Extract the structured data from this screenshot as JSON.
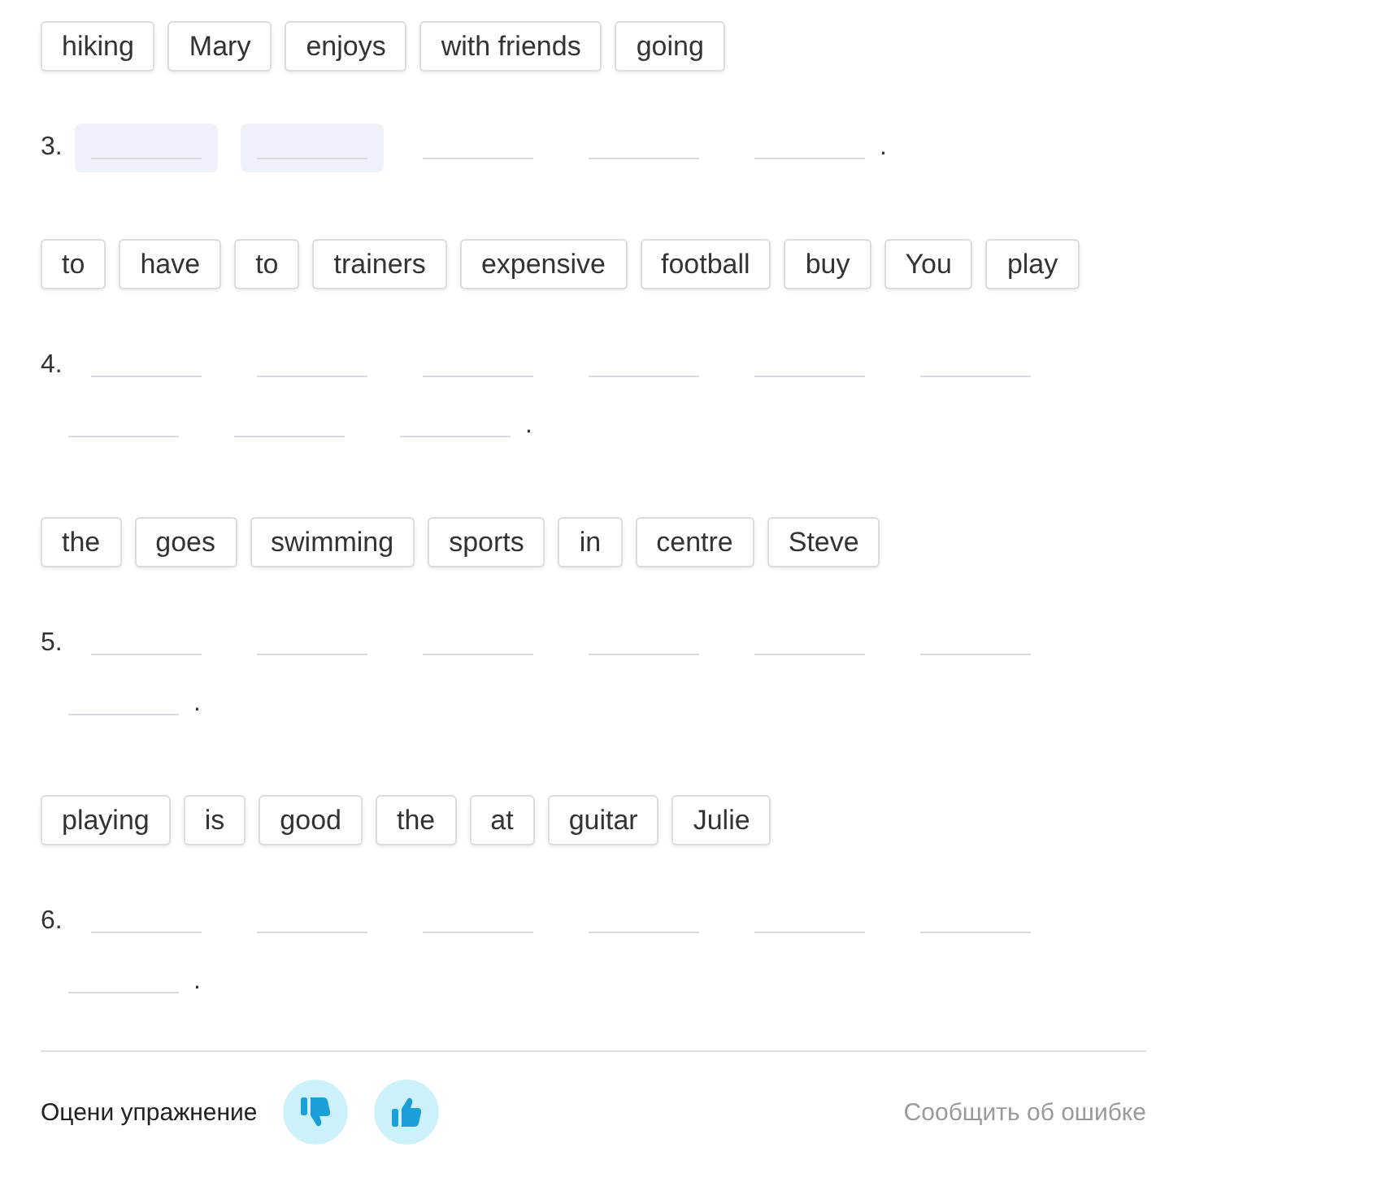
{
  "exercises": [
    {
      "words": [
        "hiking",
        "Mary",
        "enjoys",
        "with friends",
        "going"
      ],
      "number": "3.",
      "blanks": [
        {
          "highlighted": true
        },
        {
          "highlighted": true
        },
        {
          "highlighted": false
        },
        {
          "highlighted": false
        },
        {
          "highlighted": false
        }
      ],
      "end": "."
    },
    {
      "words": [
        "to",
        "have",
        "to",
        "trainers",
        "expensive",
        "football",
        "buy",
        "You",
        "play"
      ],
      "number": "4.",
      "blanks": [
        {
          "highlighted": false
        },
        {
          "highlighted": false
        },
        {
          "highlighted": false
        },
        {
          "highlighted": false
        },
        {
          "highlighted": false
        },
        {
          "highlighted": false
        },
        {
          "highlighted": false
        },
        {
          "highlighted": false
        },
        {
          "highlighted": false
        }
      ],
      "end": "."
    },
    {
      "words": [
        "the",
        "goes",
        "swimming",
        "sports",
        "in",
        "centre",
        "Steve"
      ],
      "number": "5.",
      "blanks": [
        {
          "highlighted": false
        },
        {
          "highlighted": false
        },
        {
          "highlighted": false
        },
        {
          "highlighted": false
        },
        {
          "highlighted": false
        },
        {
          "highlighted": false
        },
        {
          "highlighted": false
        }
      ],
      "end": "."
    },
    {
      "words": [
        "playing",
        "is",
        "good",
        "the",
        "at",
        "guitar",
        "Julie"
      ],
      "number": "6.",
      "blanks": [
        {
          "highlighted": false
        },
        {
          "highlighted": false
        },
        {
          "highlighted": false
        },
        {
          "highlighted": false
        },
        {
          "highlighted": false
        },
        {
          "highlighted": false
        },
        {
          "highlighted": false
        }
      ],
      "end": "."
    }
  ],
  "footer": {
    "rate_label": "Оцени упражнение",
    "report_link": "Сообщить об ошибке"
  }
}
